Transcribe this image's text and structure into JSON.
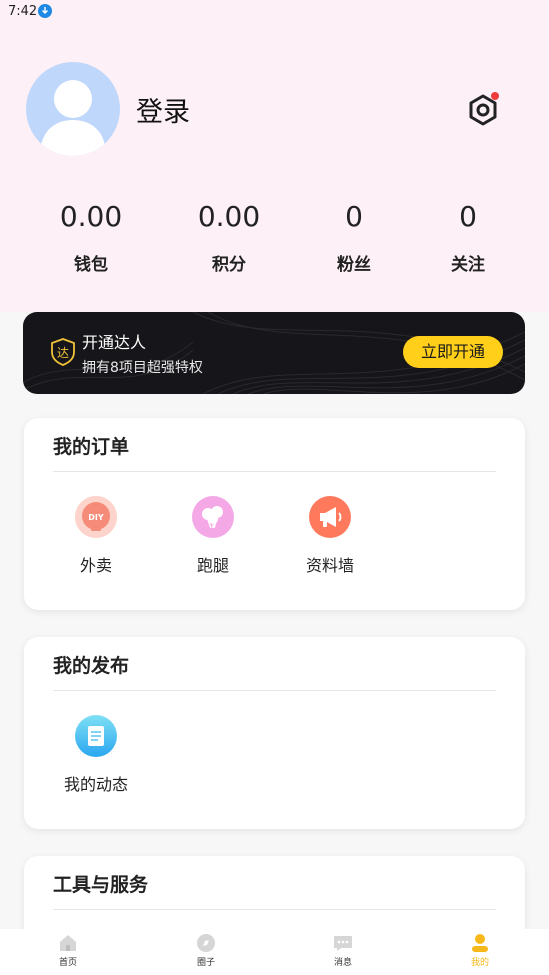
{
  "status_bar": {
    "time": "7:42"
  },
  "profile": {
    "login_label": "登录"
  },
  "stats": [
    {
      "value": "0.00",
      "label": "钱包"
    },
    {
      "value": "0.00",
      "label": "积分"
    },
    {
      "value": "0",
      "label": "粉丝"
    },
    {
      "value": "0",
      "label": "关注"
    }
  ],
  "vip": {
    "badge_char": "达",
    "title": "开通达人",
    "subtitle": "拥有8项目超强特权",
    "button_label": "立即开通"
  },
  "orders": {
    "title": "我的订单",
    "items": [
      {
        "label": "外卖",
        "icon": "diy-icon",
        "icon_text": "DIY"
      },
      {
        "label": "跑腿",
        "icon": "balloons-icon"
      },
      {
        "label": "资料墙",
        "icon": "megaphone-icon"
      }
    ]
  },
  "posts": {
    "title": "我的发布",
    "items": [
      {
        "label": "我的动态",
        "icon": "document-icon"
      }
    ]
  },
  "tools": {
    "title": "工具与服务"
  },
  "tabbar": {
    "items": [
      {
        "label": "首页",
        "icon": "home-icon"
      },
      {
        "label": "圈子",
        "icon": "circle-icon"
      },
      {
        "label": "消息",
        "icon": "message-icon"
      },
      {
        "label": "我的",
        "icon": "user-icon",
        "active": true
      }
    ]
  },
  "colors": {
    "header_bg": "#fdf0f6",
    "accent_yellow": "#ffcf1a",
    "avatar_bg": "#bfd7fb",
    "notification_dot": "#ef3b3b"
  }
}
